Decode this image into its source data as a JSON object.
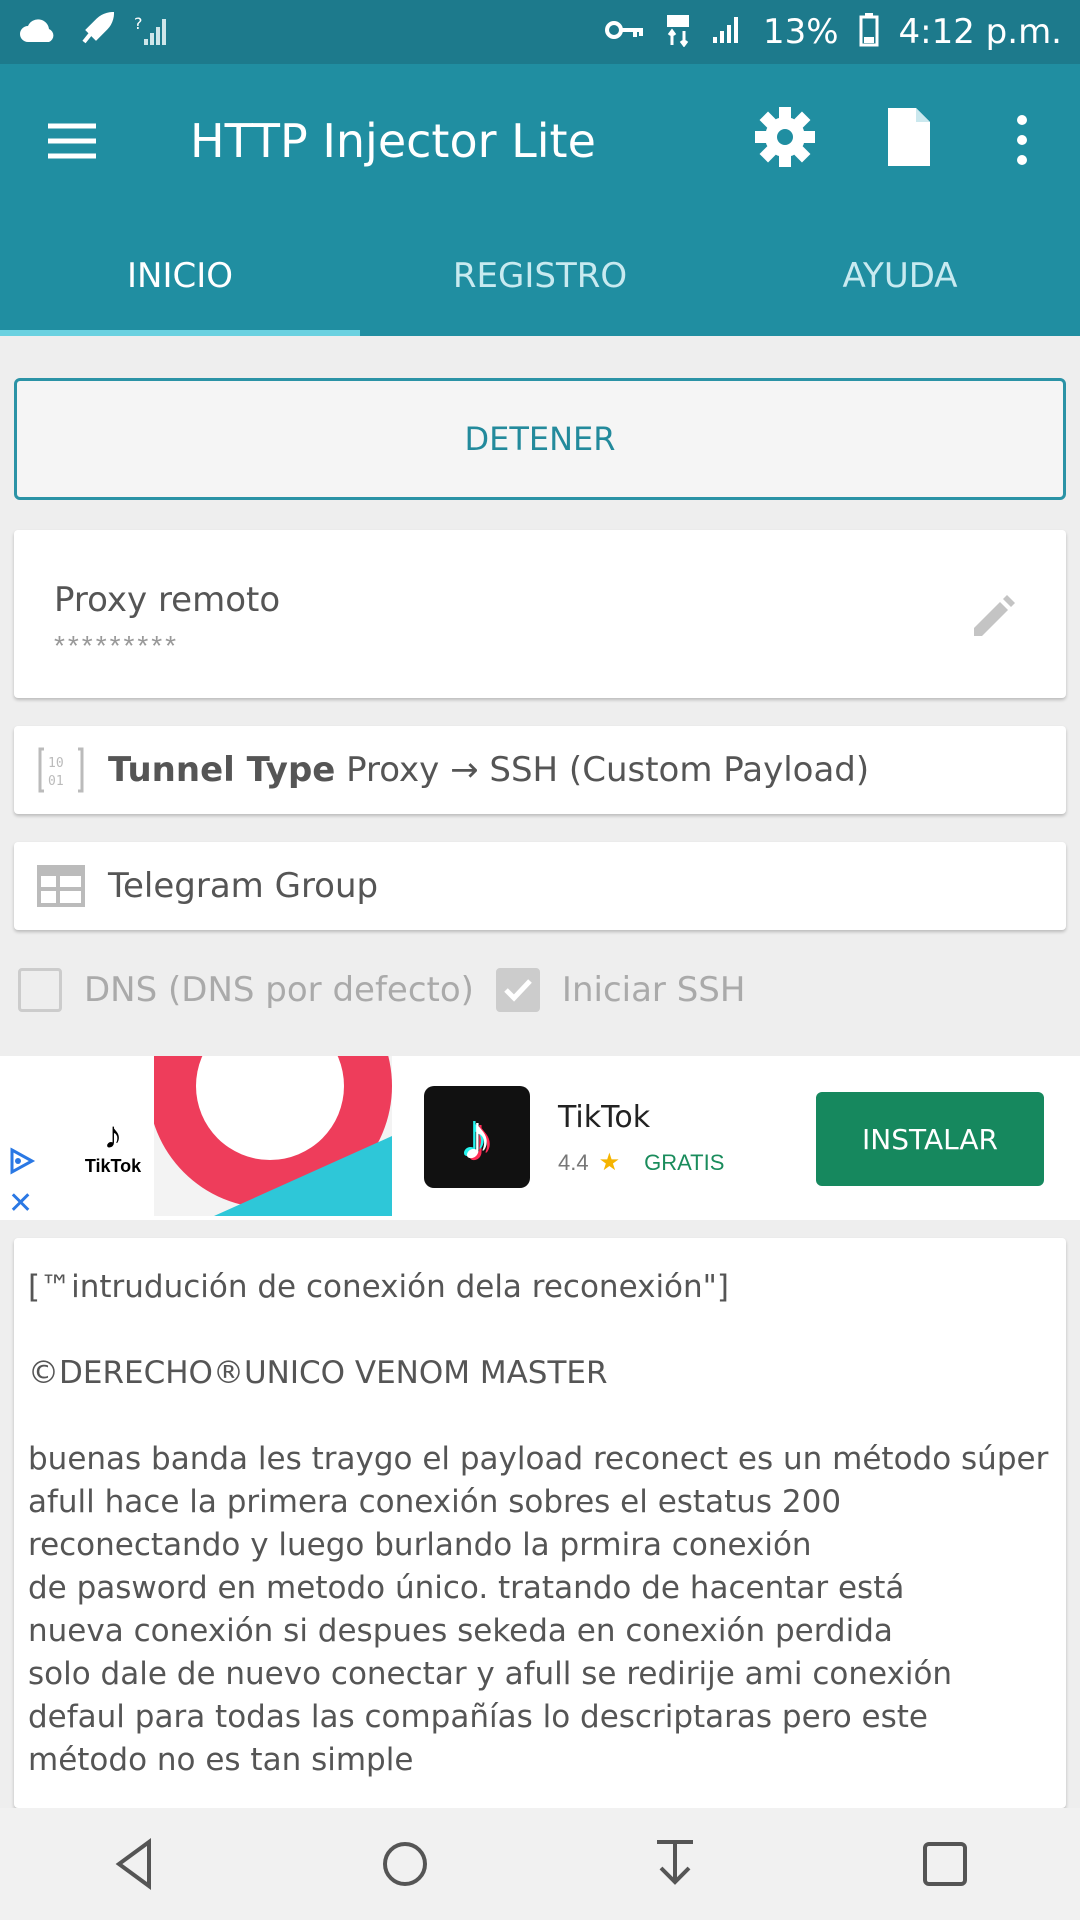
{
  "status_bar": {
    "battery": "13%",
    "time": "4:12 p.m."
  },
  "app_bar": {
    "title": "HTTP Injector Lite"
  },
  "tabs": [
    {
      "label": "INICIO",
      "active": true
    },
    {
      "label": "REGISTRO",
      "active": false
    },
    {
      "label": "AYUDA",
      "active": false
    }
  ],
  "stop_button": {
    "label": "DETENER"
  },
  "proxy": {
    "title": "Proxy remoto",
    "value": "*********"
  },
  "tunnel": {
    "label": "Tunnel Type",
    "value": "Proxy → SSH (Custom Payload)"
  },
  "telegram": {
    "label": "Telegram Group"
  },
  "options": {
    "dns": {
      "label": "DNS (DNS por defecto)",
      "checked": false
    },
    "ssh": {
      "label": "Iniciar SSH",
      "checked": true
    }
  },
  "ad": {
    "brand": "TikTok",
    "app_name": "TikTok",
    "rating": "4.4",
    "price": "GRATIS",
    "install_label": "INSTALAR"
  },
  "description": {
    "line1": "[™intrudución de conexión dela reconexión\"]",
    "line2": "©DERECHO®UNICO VENOM MASTER",
    "para": [
      "buenas banda les traygo el payload reconect es un método súper",
      "afull hace la primera conexión sobres el estatus 200",
      "reconectando y luego burlando la prmira conexión",
      "de pasword en metodo único. tratando de hacentar está",
      "nueva conexión si despues sekeda en conexión perdida",
      "solo dale de nuevo conectar y afull se redirije ami conexión",
      "defaul para todas las compañías lo descriptaras pero este",
      "método no es tan simple"
    ]
  },
  "colors": {
    "app_bar": "#208ea1",
    "status_bar": "#1d7a8c",
    "accent": "#238a9c",
    "install": "#16885e"
  }
}
